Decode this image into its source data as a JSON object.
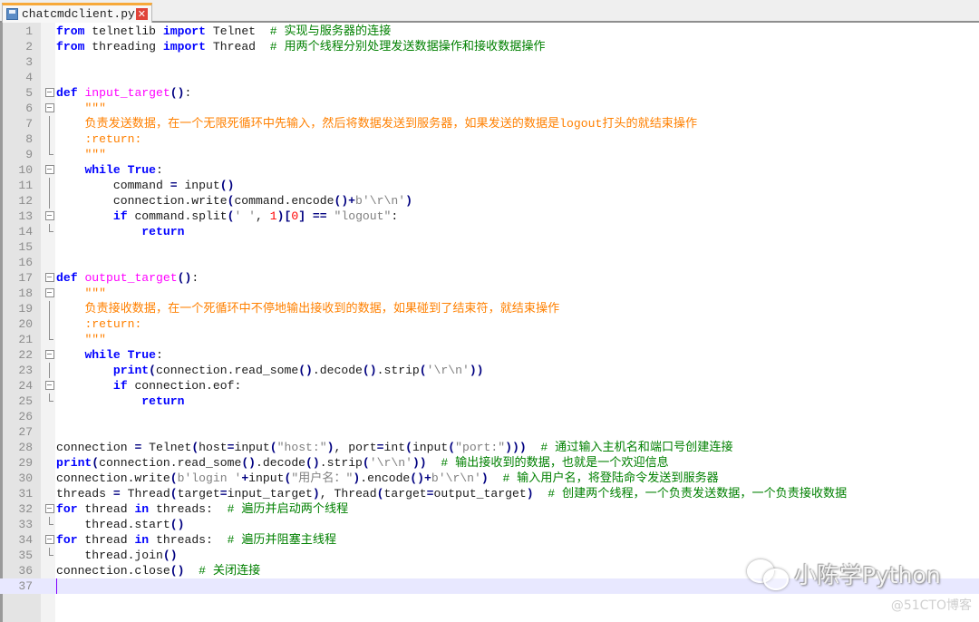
{
  "tab": {
    "filename": "chatcmdclient.py",
    "save_icon": "save-disk-icon",
    "close_icon": "close-icon",
    "close_glyph": "✕"
  },
  "editor": {
    "current_line": 37,
    "lines": [
      {
        "n": "1",
        "fold": "",
        "tokens": [
          [
            "kw",
            "from"
          ],
          [
            "id",
            " telnetlib "
          ],
          [
            "kw",
            "import"
          ],
          [
            "id",
            " Telnet  "
          ],
          [
            "cm",
            "# 实现与服务器的连接"
          ]
        ]
      },
      {
        "n": "2",
        "fold": "",
        "tokens": [
          [
            "kw",
            "from"
          ],
          [
            "id",
            " threading "
          ],
          [
            "kw",
            "import"
          ],
          [
            "id",
            " Thread  "
          ],
          [
            "cm",
            "# 用两个线程分别处理发送数据操作和接收数据操作"
          ]
        ]
      },
      {
        "n": "3",
        "fold": "",
        "tokens": []
      },
      {
        "n": "4",
        "fold": "",
        "tokens": []
      },
      {
        "n": "5",
        "fold": "box",
        "tokens": [
          [
            "kw",
            "def"
          ],
          [
            "id",
            " "
          ],
          [
            "fn",
            "input_target"
          ],
          [
            "op",
            "()"
          ],
          [
            "id",
            ":"
          ]
        ]
      },
      {
        "n": "6",
        "fold": "box",
        "tokens": [
          [
            "id",
            "    "
          ],
          [
            "doc",
            "\"\"\""
          ]
        ]
      },
      {
        "n": "7",
        "fold": "line",
        "tokens": [
          [
            "id",
            "    "
          ],
          [
            "doc",
            "负责发送数据，在一个无限死循环中先输入，然后将数据发送到服务器，如果发送的数据是logout打头的就结束操作"
          ]
        ]
      },
      {
        "n": "8",
        "fold": "line",
        "tokens": [
          [
            "id",
            "    "
          ],
          [
            "doc",
            ":return:"
          ]
        ]
      },
      {
        "n": "9",
        "fold": "end",
        "tokens": [
          [
            "id",
            "    "
          ],
          [
            "doc",
            "\"\"\""
          ]
        ]
      },
      {
        "n": "10",
        "fold": "box",
        "tokens": [
          [
            "id",
            "    "
          ],
          [
            "kw",
            "while"
          ],
          [
            "id",
            " "
          ],
          [
            "kw",
            "True"
          ],
          [
            "id",
            ":"
          ]
        ]
      },
      {
        "n": "11",
        "fold": "line",
        "tokens": [
          [
            "id",
            "        command "
          ],
          [
            "op",
            "="
          ],
          [
            "id",
            " input"
          ],
          [
            "op",
            "()"
          ]
        ]
      },
      {
        "n": "12",
        "fold": "line",
        "tokens": [
          [
            "id",
            "        connection.write"
          ],
          [
            "op",
            "("
          ],
          [
            "id",
            "command.encode"
          ],
          [
            "op",
            "()+"
          ],
          [
            "str",
            "b'\\r\\n'"
          ],
          [
            "op",
            ")"
          ]
        ]
      },
      {
        "n": "13",
        "fold": "box",
        "tokens": [
          [
            "id",
            "        "
          ],
          [
            "kw",
            "if"
          ],
          [
            "id",
            " command.split"
          ],
          [
            "op",
            "("
          ],
          [
            "str",
            "' '"
          ],
          [
            "id",
            ", "
          ],
          [
            "num",
            "1"
          ],
          [
            "op",
            ")["
          ],
          [
            "num",
            "0"
          ],
          [
            "op",
            "]"
          ],
          [
            "id",
            " "
          ],
          [
            "op",
            "=="
          ],
          [
            "id",
            " "
          ],
          [
            "str",
            "\"logout\""
          ],
          [
            "id",
            ":"
          ]
        ]
      },
      {
        "n": "14",
        "fold": "end",
        "tokens": [
          [
            "id",
            "            "
          ],
          [
            "kw",
            "return"
          ]
        ]
      },
      {
        "n": "15",
        "fold": "",
        "tokens": []
      },
      {
        "n": "16",
        "fold": "",
        "tokens": []
      },
      {
        "n": "17",
        "fold": "box",
        "tokens": [
          [
            "kw",
            "def"
          ],
          [
            "id",
            " "
          ],
          [
            "fn",
            "output_target"
          ],
          [
            "op",
            "()"
          ],
          [
            "id",
            ":"
          ]
        ]
      },
      {
        "n": "18",
        "fold": "box",
        "tokens": [
          [
            "id",
            "    "
          ],
          [
            "doc",
            "\"\"\""
          ]
        ]
      },
      {
        "n": "19",
        "fold": "line",
        "tokens": [
          [
            "id",
            "    "
          ],
          [
            "doc",
            "负责接收数据，在一个死循环中不停地输出接收到的数据，如果碰到了结束符，就结束操作"
          ]
        ]
      },
      {
        "n": "20",
        "fold": "line",
        "tokens": [
          [
            "id",
            "    "
          ],
          [
            "doc",
            ":return:"
          ]
        ]
      },
      {
        "n": "21",
        "fold": "end",
        "tokens": [
          [
            "id",
            "    "
          ],
          [
            "doc",
            "\"\"\""
          ]
        ]
      },
      {
        "n": "22",
        "fold": "box",
        "tokens": [
          [
            "id",
            "    "
          ],
          [
            "kw",
            "while"
          ],
          [
            "id",
            " "
          ],
          [
            "kw",
            "True"
          ],
          [
            "id",
            ":"
          ]
        ]
      },
      {
        "n": "23",
        "fold": "line",
        "tokens": [
          [
            "id",
            "        "
          ],
          [
            "kw",
            "print"
          ],
          [
            "op",
            "("
          ],
          [
            "id",
            "connection.read_some"
          ],
          [
            "op",
            "()"
          ],
          [
            "id",
            ".decode"
          ],
          [
            "op",
            "()"
          ],
          [
            "id",
            ".strip"
          ],
          [
            "op",
            "("
          ],
          [
            "str",
            "'\\r\\n'"
          ],
          [
            "op",
            "))"
          ]
        ]
      },
      {
        "n": "24",
        "fold": "box",
        "tokens": [
          [
            "id",
            "        "
          ],
          [
            "kw",
            "if"
          ],
          [
            "id",
            " connection.eof:"
          ]
        ]
      },
      {
        "n": "25",
        "fold": "end",
        "tokens": [
          [
            "id",
            "            "
          ],
          [
            "kw",
            "return"
          ]
        ]
      },
      {
        "n": "26",
        "fold": "",
        "tokens": []
      },
      {
        "n": "27",
        "fold": "",
        "tokens": []
      },
      {
        "n": "28",
        "fold": "",
        "tokens": [
          [
            "id",
            "connection "
          ],
          [
            "op",
            "="
          ],
          [
            "id",
            " Telnet"
          ],
          [
            "op",
            "("
          ],
          [
            "id",
            "host"
          ],
          [
            "op",
            "="
          ],
          [
            "id",
            "input"
          ],
          [
            "op",
            "("
          ],
          [
            "str",
            "\"host:\""
          ],
          [
            "op",
            ")"
          ],
          [
            "id",
            ", port"
          ],
          [
            "op",
            "="
          ],
          [
            "id",
            "int"
          ],
          [
            "op",
            "("
          ],
          [
            "id",
            "input"
          ],
          [
            "op",
            "("
          ],
          [
            "str",
            "\"port:\""
          ],
          [
            "op",
            ")))"
          ],
          [
            "id",
            "  "
          ],
          [
            "cm",
            "# 通过输入主机名和端口号创建连接"
          ]
        ]
      },
      {
        "n": "29",
        "fold": "",
        "tokens": [
          [
            "kw",
            "print"
          ],
          [
            "op",
            "("
          ],
          [
            "id",
            "connection.read_some"
          ],
          [
            "op",
            "()"
          ],
          [
            "id",
            ".decode"
          ],
          [
            "op",
            "()"
          ],
          [
            "id",
            ".strip"
          ],
          [
            "op",
            "("
          ],
          [
            "str",
            "'\\r\\n'"
          ],
          [
            "op",
            "))"
          ],
          [
            "id",
            "  "
          ],
          [
            "cm",
            "# 输出接收到的数据，也就是一个欢迎信息"
          ]
        ]
      },
      {
        "n": "30",
        "fold": "",
        "tokens": [
          [
            "id",
            "connection.write"
          ],
          [
            "op",
            "("
          ],
          [
            "str",
            "b'login '"
          ],
          [
            "op",
            "+"
          ],
          [
            "id",
            "input"
          ],
          [
            "op",
            "("
          ],
          [
            "str",
            "\"用户名：\""
          ],
          [
            "op",
            ")"
          ],
          [
            "id",
            ".encode"
          ],
          [
            "op",
            "()+"
          ],
          [
            "str",
            "b'\\r\\n'"
          ],
          [
            "op",
            ")"
          ],
          [
            "id",
            "  "
          ],
          [
            "cm",
            "# 输入用户名，将登陆命令发送到服务器"
          ]
        ]
      },
      {
        "n": "31",
        "fold": "",
        "tokens": [
          [
            "id",
            "threads "
          ],
          [
            "op",
            "="
          ],
          [
            "id",
            " Thread"
          ],
          [
            "op",
            "("
          ],
          [
            "id",
            "target"
          ],
          [
            "op",
            "="
          ],
          [
            "id",
            "input_target"
          ],
          [
            "op",
            ")"
          ],
          [
            "id",
            ", Thread"
          ],
          [
            "op",
            "("
          ],
          [
            "id",
            "target"
          ],
          [
            "op",
            "="
          ],
          [
            "id",
            "output_target"
          ],
          [
            "op",
            ")"
          ],
          [
            "id",
            "  "
          ],
          [
            "cm",
            "# 创建两个线程，一个负责发送数据，一个负责接收数据"
          ]
        ]
      },
      {
        "n": "32",
        "fold": "box",
        "tokens": [
          [
            "kw",
            "for"
          ],
          [
            "id",
            " thread "
          ],
          [
            "kw",
            "in"
          ],
          [
            "id",
            " threads:  "
          ],
          [
            "cm",
            "# 遍历并启动两个线程"
          ]
        ]
      },
      {
        "n": "33",
        "fold": "end",
        "tokens": [
          [
            "id",
            "    thread.start"
          ],
          [
            "op",
            "()"
          ]
        ]
      },
      {
        "n": "34",
        "fold": "box",
        "tokens": [
          [
            "kw",
            "for"
          ],
          [
            "id",
            " thread "
          ],
          [
            "kw",
            "in"
          ],
          [
            "id",
            " threads:  "
          ],
          [
            "cm",
            "# 遍历并阻塞主线程"
          ]
        ]
      },
      {
        "n": "35",
        "fold": "end",
        "tokens": [
          [
            "id",
            "    thread.join"
          ],
          [
            "op",
            "()"
          ]
        ]
      },
      {
        "n": "36",
        "fold": "",
        "tokens": [
          [
            "id",
            "connection.close"
          ],
          [
            "op",
            "()"
          ],
          [
            "id",
            "  "
          ],
          [
            "cm",
            "# 关闭连接"
          ]
        ]
      },
      {
        "n": "37",
        "fold": "",
        "tokens": []
      }
    ]
  },
  "watermark": {
    "icon": "wechat-icon",
    "text": "小陈学Python",
    "site": "@51CTO博客"
  }
}
